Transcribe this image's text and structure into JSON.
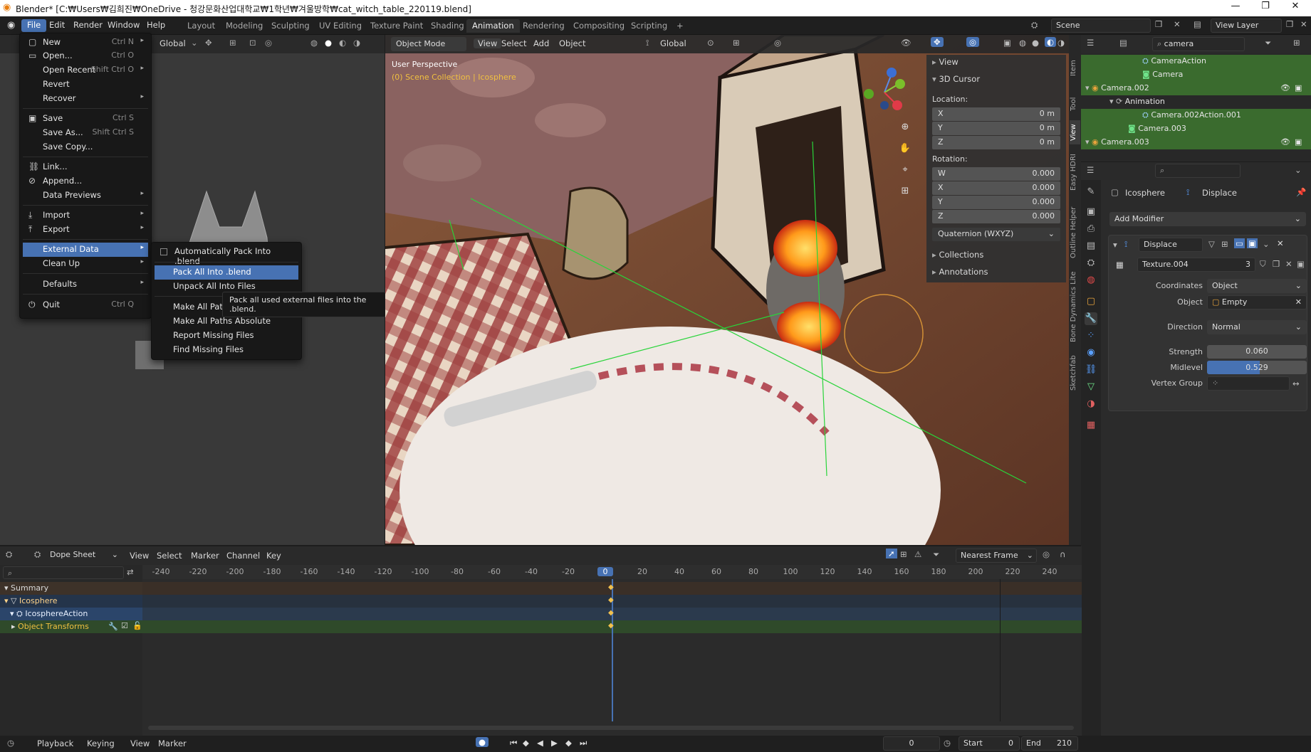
{
  "window": {
    "title": "Blender* [C:₩Users₩김희진₩OneDrive - 청강문화산업대학교₩1학년₩겨울방학₩cat_witch_table_220119.blend]",
    "minimize": "—",
    "maximize": "❐",
    "close": "✕"
  },
  "topmenu": [
    "File",
    "Edit",
    "Render",
    "Window",
    "Help"
  ],
  "workspaces": [
    "Layout",
    "Modeling",
    "Sculpting",
    "UV Editing",
    "Texture Paint",
    "Shading",
    "Animation",
    "Rendering",
    "Compositing",
    "Scripting",
    "+"
  ],
  "active_workspace": "Animation",
  "scene": {
    "label": "Scene",
    "view_layer": "View Layer"
  },
  "file_menu": {
    "items": [
      {
        "label": "New",
        "shortcut": "Ctrl N",
        "arrow": "▸"
      },
      {
        "label": "Open...",
        "shortcut": "Ctrl O"
      },
      {
        "label": "Open Recent",
        "shortcut": "Shift Ctrl O",
        "arrow": "▸"
      },
      {
        "label": "Revert"
      },
      {
        "label": "Recover",
        "arrow": "▸"
      },
      {
        "label": "Save",
        "shortcut": "Ctrl S"
      },
      {
        "label": "Save As...",
        "shortcut": "Shift Ctrl S"
      },
      {
        "label": "Save Copy..."
      },
      {
        "label": "Link..."
      },
      {
        "label": "Append..."
      },
      {
        "label": "Data Previews",
        "arrow": "▸"
      },
      {
        "label": "Import",
        "arrow": "▸"
      },
      {
        "label": "Export",
        "arrow": "▸"
      },
      {
        "label": "External Data",
        "arrow": "▸"
      },
      {
        "label": "Clean Up",
        "arrow": "▸"
      },
      {
        "label": "Defaults",
        "arrow": "▸"
      },
      {
        "label": "Quit",
        "shortcut": "Ctrl Q"
      }
    ]
  },
  "external_submenu": {
    "auto_pack": "Automatically Pack Into .blend",
    "items": [
      "Pack All Into .blend",
      "Unpack All Into Files",
      "Make All Paths Relative",
      "Make All Paths Absolute",
      "Report Missing Files",
      "Find Missing Files"
    ],
    "tooltip": "Pack all used external files into the .blend."
  },
  "left_header": {
    "orientation": "Global"
  },
  "viewport": {
    "mode": "Object Mode",
    "menus": [
      "View",
      "Select",
      "Add",
      "Object"
    ],
    "orientation": "Global",
    "overlay_title": "User Perspective",
    "overlay_sub": "(0) Scene Collection | Icosphere"
  },
  "npanel": {
    "view": "View",
    "cursor": "3D Cursor",
    "location_label": "Location:",
    "location": [
      {
        "axis": "X",
        "value": "0 m"
      },
      {
        "axis": "Y",
        "value": "0 m"
      },
      {
        "axis": "Z",
        "value": "0 m"
      }
    ],
    "rotation_label": "Rotation:",
    "rotation": [
      {
        "axis": "W",
        "value": "0.000"
      },
      {
        "axis": "X",
        "value": "0.000"
      },
      {
        "axis": "Y",
        "value": "0.000"
      },
      {
        "axis": "Z",
        "value": "0.000"
      }
    ],
    "rotation_mode": "Quaternion (WXYZ)",
    "collections": "Collections",
    "annotations": "Annotations"
  },
  "vertical_tabs": [
    "Item",
    "Tool",
    "View",
    "Easy HDRI",
    "Outline Helper",
    "Bone Dynamics Lite",
    "Sketchfab"
  ],
  "outliner": {
    "search": "camera",
    "rows": [
      "CameraAction",
      "Camera",
      "Camera.002",
      "Animation",
      "Camera.002Action.001",
      "Camera.003",
      "Camera.003"
    ]
  },
  "properties": {
    "object": "Icosphere",
    "modifier_tab": "Displace",
    "add_modifier": "Add Modifier",
    "modifier_name": "Displace",
    "texture": "Texture.004",
    "texture_users": "3",
    "coordinates_label": "Coordinates",
    "coordinates": "Object",
    "object_label": "Object",
    "object_value": "Empty",
    "direction_label": "Direction",
    "direction": "Normal",
    "strength_label": "Strength",
    "strength": "0.060",
    "midlevel_label": "Midlevel",
    "midlevel": "0.529",
    "midlevel_fraction": 0.529,
    "vertex_group_label": "Vertex Group"
  },
  "dopesheet": {
    "editor": "Dope Sheet",
    "menus": [
      "View",
      "Select",
      "Marker",
      "Channel",
      "Key"
    ],
    "snap": "Nearest Frame",
    "current_frame_label": "0",
    "ticks": [
      "-240",
      "-220",
      "-200",
      "-180",
      "-160",
      "-140",
      "-120",
      "-100",
      "-80",
      "-60",
      "-40",
      "-20",
      "0",
      "20",
      "40",
      "60",
      "80",
      "100",
      "120",
      "140",
      "160",
      "180",
      "200",
      "220",
      "240"
    ],
    "channels": [
      "Summary",
      "Icosphere",
      "IcosphereAction",
      "Object Transforms"
    ]
  },
  "footer": {
    "menus": [
      "Playback",
      "Keying",
      "View",
      "Marker"
    ],
    "frame": "0",
    "start_label": "Start",
    "start": "0",
    "end_label": "End",
    "end": "210"
  },
  "colors": {
    "accent": "#4772b3",
    "outliner_select": "#3a6b2e",
    "keyframe": "#f2c14e"
  }
}
